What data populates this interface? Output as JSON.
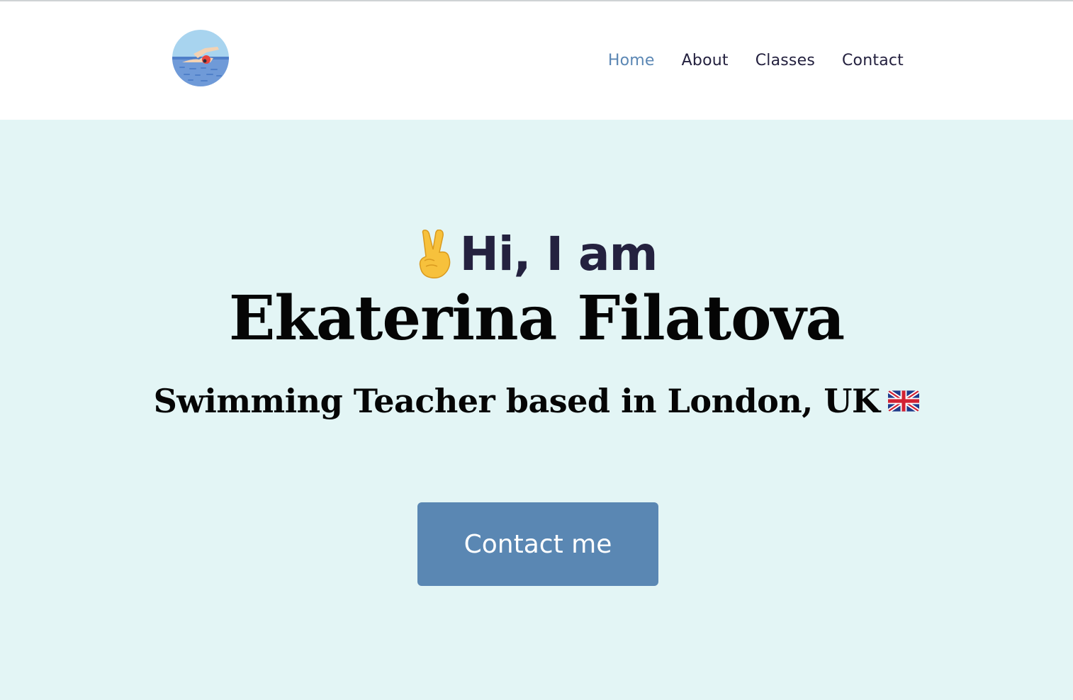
{
  "header": {
    "logo_icon": "swimmer-icon",
    "nav": [
      {
        "label": "Home",
        "active": true
      },
      {
        "label": "About",
        "active": false
      },
      {
        "label": "Classes",
        "active": false
      },
      {
        "label": "Contact",
        "active": false
      }
    ]
  },
  "hero": {
    "greeting": "Hi, I am",
    "greeting_icon": "victory-hand-icon",
    "name": "Ekaterina Filatova",
    "subtitle": "Swimming Teacher based in London, UK",
    "subtitle_icon": "uk-flag-icon",
    "cta_label": "Contact me"
  },
  "colors": {
    "accent": "#5a87b3",
    "hero_background": "#e3f5f5",
    "nav_text": "#24213f",
    "nav_active": "#5b87b4",
    "heading_dark": "#24213f",
    "title_black": "#050505"
  }
}
